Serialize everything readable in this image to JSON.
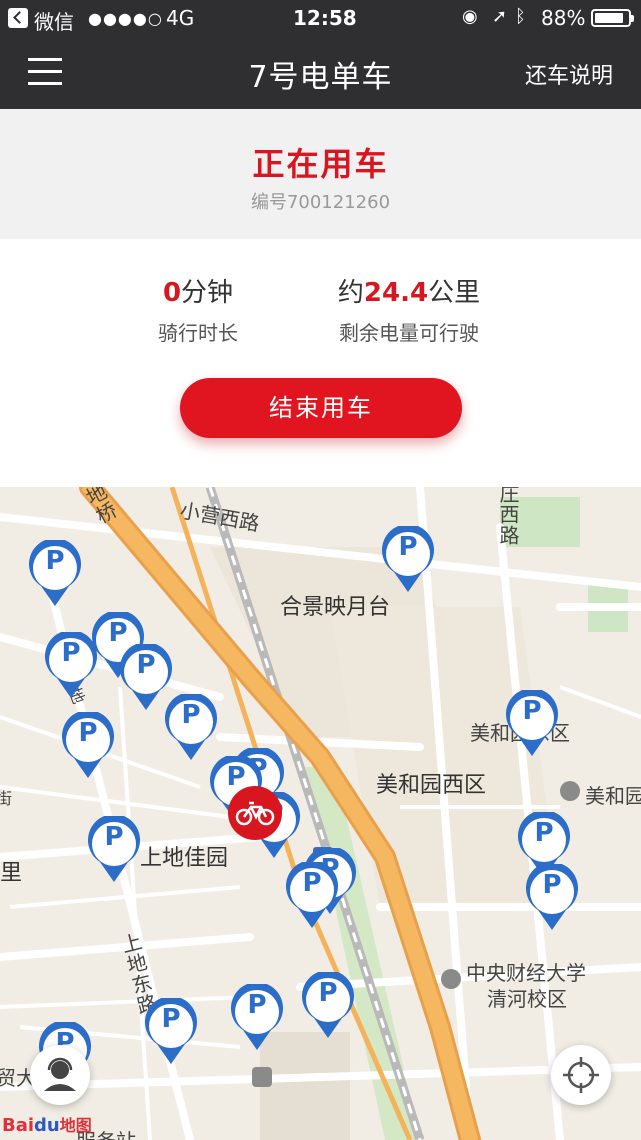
{
  "status_bar": {
    "carrier": "微信",
    "signal_dots": "●●●●○",
    "network": "4G",
    "time": "12:58",
    "battery": "88%",
    "battery_level": 0.88
  },
  "nav": {
    "title": "7号电单车",
    "right_label": "还车说明"
  },
  "ride_status": {
    "title": "正在用车",
    "bike_id": "编号700121260"
  },
  "stats": {
    "duration_value": "0",
    "duration_unit": "分钟",
    "duration_label": "骑行时长",
    "range_prefix": "约",
    "range_value": "24.4",
    "range_unit": "公里",
    "range_label": "剩余电量可行驶"
  },
  "actions": {
    "end_ride": "结束用车"
  },
  "map": {
    "pin_letter": "P",
    "labels": {
      "xiaoying_xilu": "小营西路",
      "hejing_yingyuetai": "合景映月台",
      "meiheyuan_xiqu": "美和园西区",
      "meiheyuan_dongqu_partial": "美和园东区",
      "meihe_partial": "美和园",
      "shangdi_jiayuan": "上地佳园",
      "dongli_partial": "东里",
      "shangdi_donglu": "上地东路",
      "cufe_line1": "中央财经大学",
      "cufe_line2": "清河校区",
      "zhuang_xilu": "庄西路",
      "qiao_partial": "地桥",
      "di_partial": "地",
      "jie_partial": "街",
      "dasha_partial": "贸大厦",
      "service_station": "服务站"
    },
    "logo_baidu": "Bai",
    "logo_du": "du",
    "logo_map": "地图"
  },
  "colors": {
    "nav_bg": "#2f2f31",
    "accent_red": "#d8161f",
    "pin_blue": "#2b6dc9"
  }
}
